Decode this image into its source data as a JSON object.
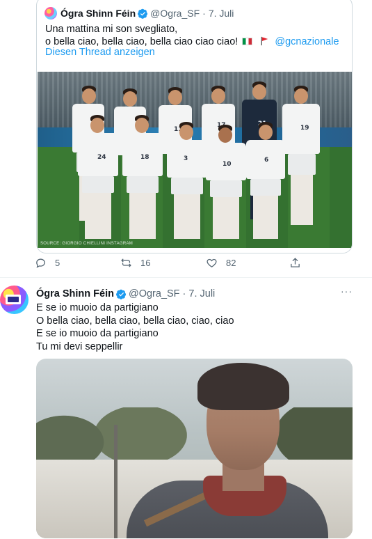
{
  "quoted_tweet": {
    "name": "Ógra Shinn Féin",
    "handle": "@Ogra_SF",
    "separator": "·",
    "date": "7. Juli",
    "text_line1": "Una mattina mi son svegliato,",
    "text_line2_prefix": "o bella ciao, bella ciao, bella ciao ciao ciao!",
    "text_line2_mention": "@gcnazionale",
    "show_thread": "Diesen Thread anzeigen",
    "photo_credit": "SOURCE: GIORGIO CHIELLINI INSTAGRAM"
  },
  "actions": {
    "replies": "5",
    "retweets": "16",
    "likes": "82"
  },
  "tweet": {
    "name": "Ógra Shinn Féin",
    "handle": "@Ogra_SF",
    "separator": "·",
    "date": "7. Juli",
    "more": "···",
    "lines": [
      "E se io muoio da partigiano",
      "O bella ciao, bella ciao, bella ciao, ciao, ciao",
      "E se io muoio da partigiano",
      "Tu mi devi seppellir"
    ]
  },
  "colors": {
    "accent": "#1d9bf0",
    "muted": "#536471",
    "border": "#cfd9de"
  }
}
